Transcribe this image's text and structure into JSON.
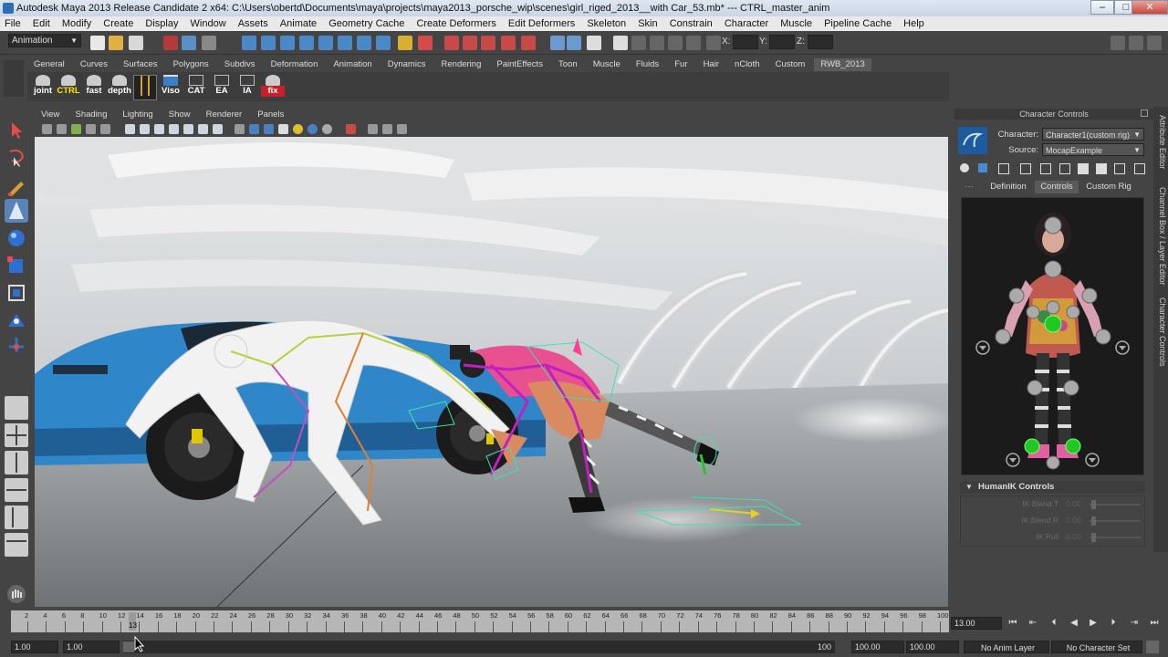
{
  "window": {
    "title": "Autodesk Maya 2013 Release Candidate 2 x64: C:\\Users\\obertd\\Documents\\maya\\projects\\maya2013_porsche_wip\\scenes\\girl_riged_2013__with Car_53.mb*  ---  CTRL_master_anim",
    "btn_min": "–",
    "btn_max": "□",
    "btn_close": "✕"
  },
  "menubar": [
    "File",
    "Edit",
    "Modify",
    "Create",
    "Display",
    "Window",
    "Assets",
    "Animate",
    "Geometry Cache",
    "Create Deformers",
    "Edit Deformers",
    "Skeleton",
    "Skin",
    "Constrain",
    "Character",
    "Muscle",
    "Pipeline Cache",
    "Help"
  ],
  "statusline": {
    "menu_set": "Animation",
    "x_label": "X:",
    "y_label": "Y:",
    "z_label": "Z:"
  },
  "shelf": {
    "tabs": [
      "General",
      "Curves",
      "Surfaces",
      "Polygons",
      "Subdivs",
      "Deformation",
      "Animation",
      "Dynamics",
      "Rendering",
      "PaintEffects",
      "Toon",
      "Muscle",
      "Fluids",
      "Fur",
      "Hair",
      "nCloth",
      "Custom",
      "RWB_2013"
    ],
    "active_tab": "RWB_2013",
    "buttons": [
      "joint",
      "CTRL",
      "fast",
      "depth",
      "",
      "Viso",
      "CAT",
      "EA",
      "IA",
      "fix"
    ]
  },
  "viewport": {
    "menu": [
      "View",
      "Shading",
      "Lighting",
      "Show",
      "Renderer",
      "Panels"
    ]
  },
  "character_controls": {
    "title": "Character Controls",
    "character_label": "Character:",
    "character_value": "Character1(custom rig)",
    "source_label": "Source:",
    "source_value": "MocapExample",
    "tabs": [
      "Definition",
      "Controls",
      "Custom Rig"
    ],
    "active_tab": "Controls",
    "humanik_header": "HumanIK Controls",
    "ik_rows": [
      {
        "name": "IK Blend T",
        "value": "0.00"
      },
      {
        "name": "IK Blend R",
        "value": "0.00"
      },
      {
        "name": "IK Pull",
        "value": "0.00"
      }
    ]
  },
  "side_tabs": [
    "Attribute Editor",
    "Channel Box / Layer Editor",
    "Character Controls"
  ],
  "timeline": {
    "ticks": [
      "2",
      "4",
      "6",
      "8",
      "10",
      "12",
      "14",
      "16",
      "18",
      "20",
      "22",
      "24",
      "26",
      "28",
      "30",
      "32",
      "34",
      "36",
      "38",
      "40",
      "42",
      "44",
      "46",
      "48",
      "50",
      "52",
      "54",
      "56",
      "58",
      "60",
      "62",
      "64",
      "66",
      "68",
      "70",
      "72",
      "74",
      "76",
      "78",
      "80",
      "82",
      "84",
      "86",
      "88",
      "90",
      "92",
      "94",
      "96",
      "98",
      "100"
    ],
    "current_frame": "13",
    "current_frame_field": "13.00"
  },
  "range": {
    "start": "1.00",
    "playback_start": "1.00",
    "playback_end": "100",
    "end": "100.00",
    "anim_end": "100.00",
    "anim_layer": "No Anim Layer",
    "character_set": "No Character Set"
  }
}
